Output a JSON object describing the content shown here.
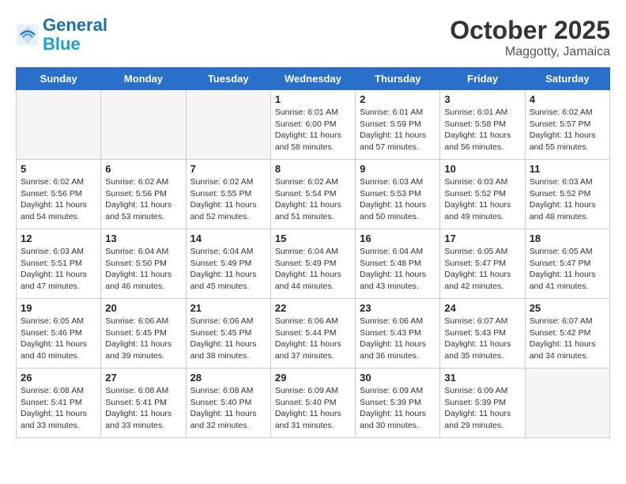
{
  "header": {
    "logo_line1": "General",
    "logo_line2": "Blue",
    "month": "October 2025",
    "location": "Maggotty, Jamaica"
  },
  "weekdays": [
    "Sunday",
    "Monday",
    "Tuesday",
    "Wednesday",
    "Thursday",
    "Friday",
    "Saturday"
  ],
  "weeks": [
    [
      {
        "day": "",
        "empty": true
      },
      {
        "day": "",
        "empty": true
      },
      {
        "day": "",
        "empty": true
      },
      {
        "day": "1",
        "rise": "6:01 AM",
        "set": "6:00 PM",
        "daylight": "11 hours and 58 minutes."
      },
      {
        "day": "2",
        "rise": "6:01 AM",
        "set": "5:59 PM",
        "daylight": "11 hours and 57 minutes."
      },
      {
        "day": "3",
        "rise": "6:01 AM",
        "set": "5:58 PM",
        "daylight": "11 hours and 56 minutes."
      },
      {
        "day": "4",
        "rise": "6:02 AM",
        "set": "5:57 PM",
        "daylight": "11 hours and 55 minutes."
      }
    ],
    [
      {
        "day": "5",
        "rise": "6:02 AM",
        "set": "5:56 PM",
        "daylight": "11 hours and 54 minutes."
      },
      {
        "day": "6",
        "rise": "6:02 AM",
        "set": "5:56 PM",
        "daylight": "11 hours and 53 minutes."
      },
      {
        "day": "7",
        "rise": "6:02 AM",
        "set": "5:55 PM",
        "daylight": "11 hours and 52 minutes."
      },
      {
        "day": "8",
        "rise": "6:02 AM",
        "set": "5:54 PM",
        "daylight": "11 hours and 51 minutes."
      },
      {
        "day": "9",
        "rise": "6:03 AM",
        "set": "5:53 PM",
        "daylight": "11 hours and 50 minutes."
      },
      {
        "day": "10",
        "rise": "6:03 AM",
        "set": "5:52 PM",
        "daylight": "11 hours and 49 minutes."
      },
      {
        "day": "11",
        "rise": "6:03 AM",
        "set": "5:52 PM",
        "daylight": "11 hours and 48 minutes."
      }
    ],
    [
      {
        "day": "12",
        "rise": "6:03 AM",
        "set": "5:51 PM",
        "daylight": "11 hours and 47 minutes."
      },
      {
        "day": "13",
        "rise": "6:04 AM",
        "set": "5:50 PM",
        "daylight": "11 hours and 46 minutes."
      },
      {
        "day": "14",
        "rise": "6:04 AM",
        "set": "5:49 PM",
        "daylight": "11 hours and 45 minutes."
      },
      {
        "day": "15",
        "rise": "6:04 AM",
        "set": "5:49 PM",
        "daylight": "11 hours and 44 minutes."
      },
      {
        "day": "16",
        "rise": "6:04 AM",
        "set": "5:48 PM",
        "daylight": "11 hours and 43 minutes."
      },
      {
        "day": "17",
        "rise": "6:05 AM",
        "set": "5:47 PM",
        "daylight": "11 hours and 42 minutes."
      },
      {
        "day": "18",
        "rise": "6:05 AM",
        "set": "5:47 PM",
        "daylight": "11 hours and 41 minutes."
      }
    ],
    [
      {
        "day": "19",
        "rise": "6:05 AM",
        "set": "5:46 PM",
        "daylight": "11 hours and 40 minutes."
      },
      {
        "day": "20",
        "rise": "6:06 AM",
        "set": "5:45 PM",
        "daylight": "11 hours and 39 minutes."
      },
      {
        "day": "21",
        "rise": "6:06 AM",
        "set": "5:45 PM",
        "daylight": "11 hours and 38 minutes."
      },
      {
        "day": "22",
        "rise": "6:06 AM",
        "set": "5:44 PM",
        "daylight": "11 hours and 37 minutes."
      },
      {
        "day": "23",
        "rise": "6:06 AM",
        "set": "5:43 PM",
        "daylight": "11 hours and 36 minutes."
      },
      {
        "day": "24",
        "rise": "6:07 AM",
        "set": "5:43 PM",
        "daylight": "11 hours and 35 minutes."
      },
      {
        "day": "25",
        "rise": "6:07 AM",
        "set": "5:42 PM",
        "daylight": "11 hours and 34 minutes."
      }
    ],
    [
      {
        "day": "26",
        "rise": "6:08 AM",
        "set": "5:41 PM",
        "daylight": "11 hours and 33 minutes."
      },
      {
        "day": "27",
        "rise": "6:08 AM",
        "set": "5:41 PM",
        "daylight": "11 hours and 33 minutes."
      },
      {
        "day": "28",
        "rise": "6:08 AM",
        "set": "5:40 PM",
        "daylight": "11 hours and 32 minutes."
      },
      {
        "day": "29",
        "rise": "6:09 AM",
        "set": "5:40 PM",
        "daylight": "11 hours and 31 minutes."
      },
      {
        "day": "30",
        "rise": "6:09 AM",
        "set": "5:39 PM",
        "daylight": "11 hours and 30 minutes."
      },
      {
        "day": "31",
        "rise": "6:09 AM",
        "set": "5:39 PM",
        "daylight": "11 hours and 29 minutes."
      },
      {
        "day": "",
        "empty": true
      }
    ]
  ]
}
